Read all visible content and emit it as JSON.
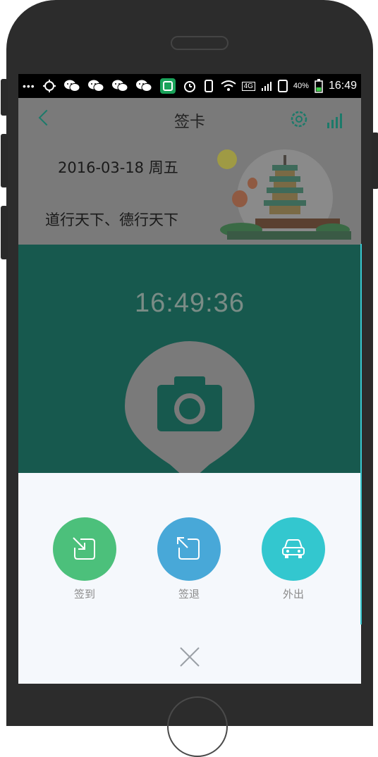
{
  "statusbar": {
    "dots": "•••",
    "network": "4G",
    "battery_percent": "40%",
    "time": "16:49",
    "icons": [
      "more-icon",
      "gps-icon",
      "wechat-icon",
      "wechat-icon",
      "wechat-icon",
      "wechat-icon",
      "app-notification-icon",
      "alarm-icon",
      "vibrate-icon",
      "wifi-icon",
      "cell-signal-icon",
      "sim-icon",
      "battery-icon"
    ]
  },
  "header": {
    "title": "签卡",
    "icons": [
      "back-icon",
      "gear-icon",
      "signal-bars-icon"
    ]
  },
  "banner": {
    "date": "2016-03-18 周五",
    "slogan": "道行天下、德行天下"
  },
  "main": {
    "clock": "16:49:36",
    "camera_icon": "camera-icon"
  },
  "sheet": {
    "actions": [
      {
        "label": "签到",
        "color": "#4cc07b",
        "icon": "sign-in-icon"
      },
      {
        "label": "签退",
        "color": "#48a8d8",
        "icon": "sign-out-icon"
      },
      {
        "label": "外出",
        "color": "#33c7cf",
        "icon": "car-icon"
      }
    ],
    "close_icon": "close-icon"
  },
  "colors": {
    "teal_dark": "#17594e",
    "overlay_gray": "#7a7a7a",
    "sheet_bg": "#f5f8fc",
    "phone_body": "#2c2c2c"
  }
}
